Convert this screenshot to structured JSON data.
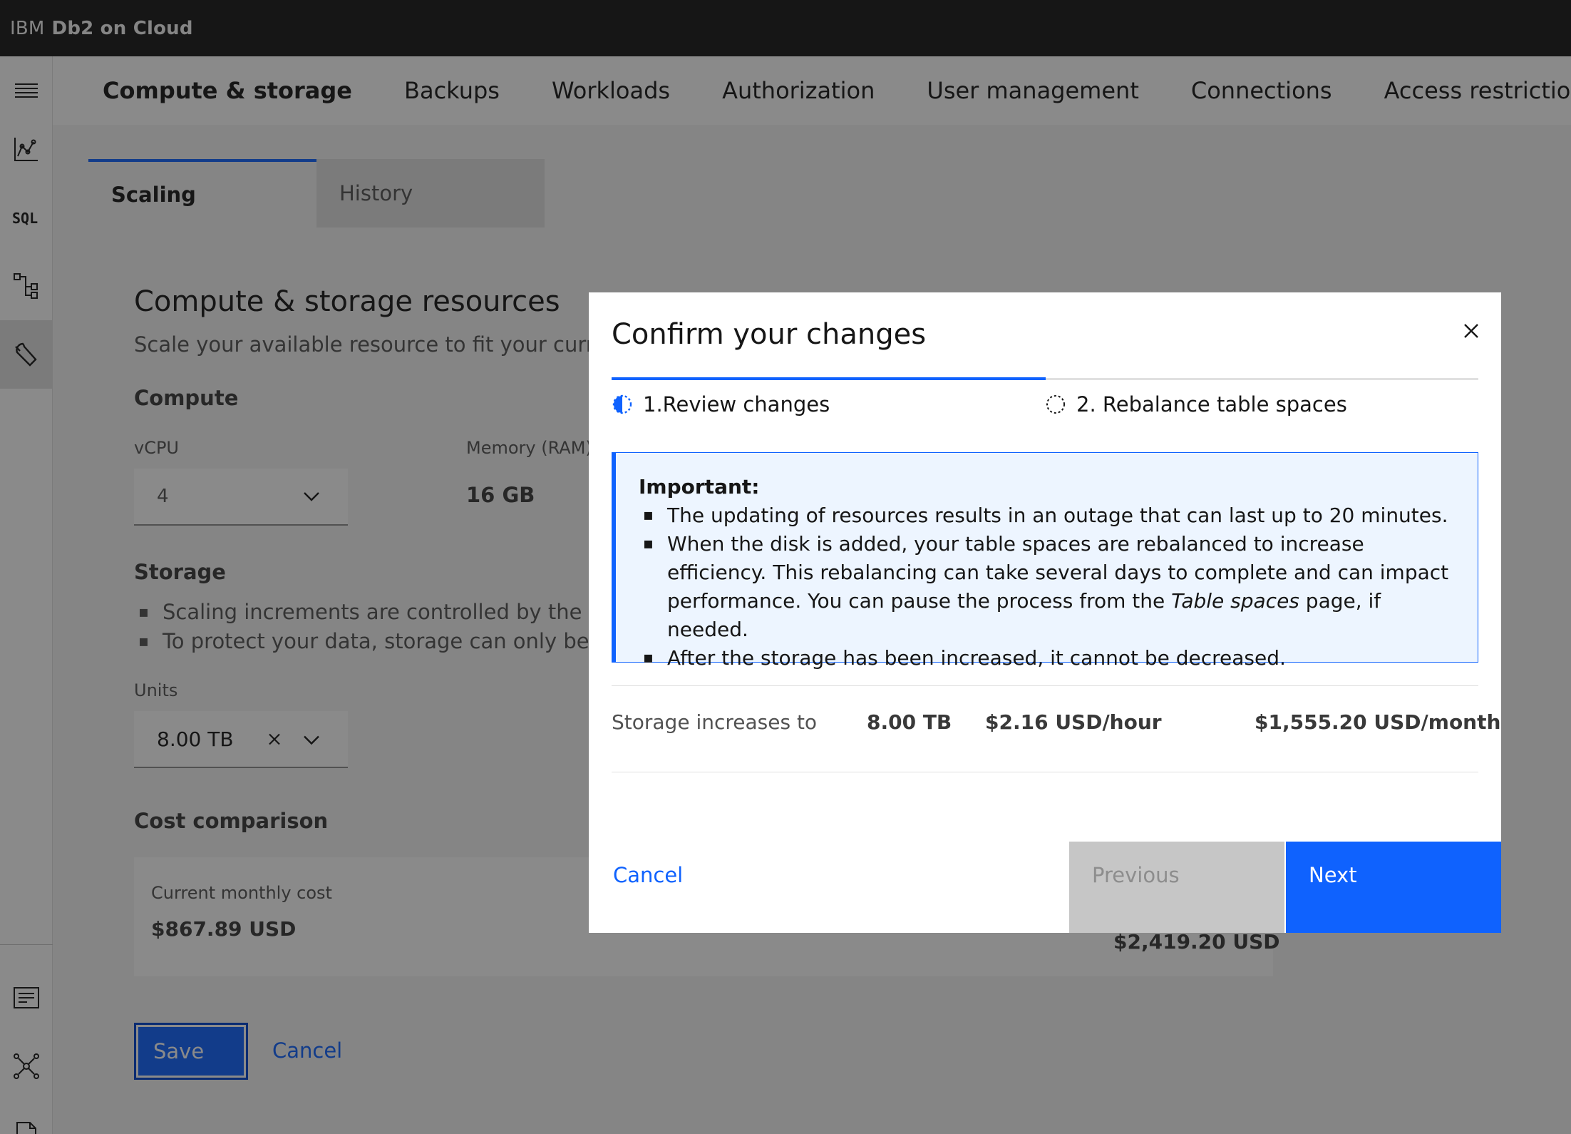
{
  "topbar": {
    "brand": "IBM",
    "product": "Db2 on Cloud"
  },
  "rail": {
    "icons": [
      "menu-icon",
      "monitor-chart-icon",
      "sql-icon",
      "data-tree-icon",
      "wrench-icon",
      "doc-list-icon",
      "network-icon",
      "document-icon"
    ]
  },
  "nav": {
    "items": [
      "Compute & storage",
      "Backups",
      "Workloads",
      "Authorization",
      "User management",
      "Connections",
      "Access restriction"
    ]
  },
  "tabs": [
    "Scaling",
    "History"
  ],
  "page": {
    "title": "Compute & storage resources",
    "description": "Scale your available resource to fit your current ne",
    "compute_label": "Compute",
    "vcpu_label": "vCPU",
    "vcpu_value": "4",
    "memory_label": "Memory (RAM)",
    "memory_value": "16 GB",
    "storage_label": "Storage",
    "storage_bullets": [
      "Scaling increments are controlled by the active",
      "To protect your data, storage can only be incre"
    ],
    "units_label": "Units",
    "units_value": "8.00 TB",
    "cost_label": "Cost comparison",
    "current_cost_label": "Current monthly cost",
    "current_cost_value": "$867.89 USD",
    "new_cost_value": "$2,419.20 USD",
    "save_label": "Save",
    "cancel_label": "Cancel"
  },
  "modal": {
    "title": "Confirm your changes",
    "steps": [
      "1.Review changes",
      "2. Rebalance table spaces"
    ],
    "notice": {
      "title": "Important:",
      "bullets": [
        "The updating of resources results in an outage that can last up to 20 minutes.",
        "When the disk is added, your table spaces are rebalanced to increase efficiency. This rebalancing can take several days to complete and can impact performance. You can pause the process from the",
        "After the storage has been increased, it cannot be decreased."
      ],
      "italic_text": "Table spaces",
      "bullet2_tail": "page, if needed."
    },
    "row": {
      "label": "Storage increases to",
      "size": "8.00 TB",
      "hourly": "$2.16 USD/hour",
      "monthly": "$1,555.20 USD/month"
    },
    "cancel_label": "Cancel",
    "previous_label": "Previous",
    "next_label": "Next"
  },
  "colors": {
    "primary": "#0f62fe",
    "topbar": "#161616",
    "notice_bg": "#edf5ff",
    "disabled": "#c6c6c6"
  }
}
